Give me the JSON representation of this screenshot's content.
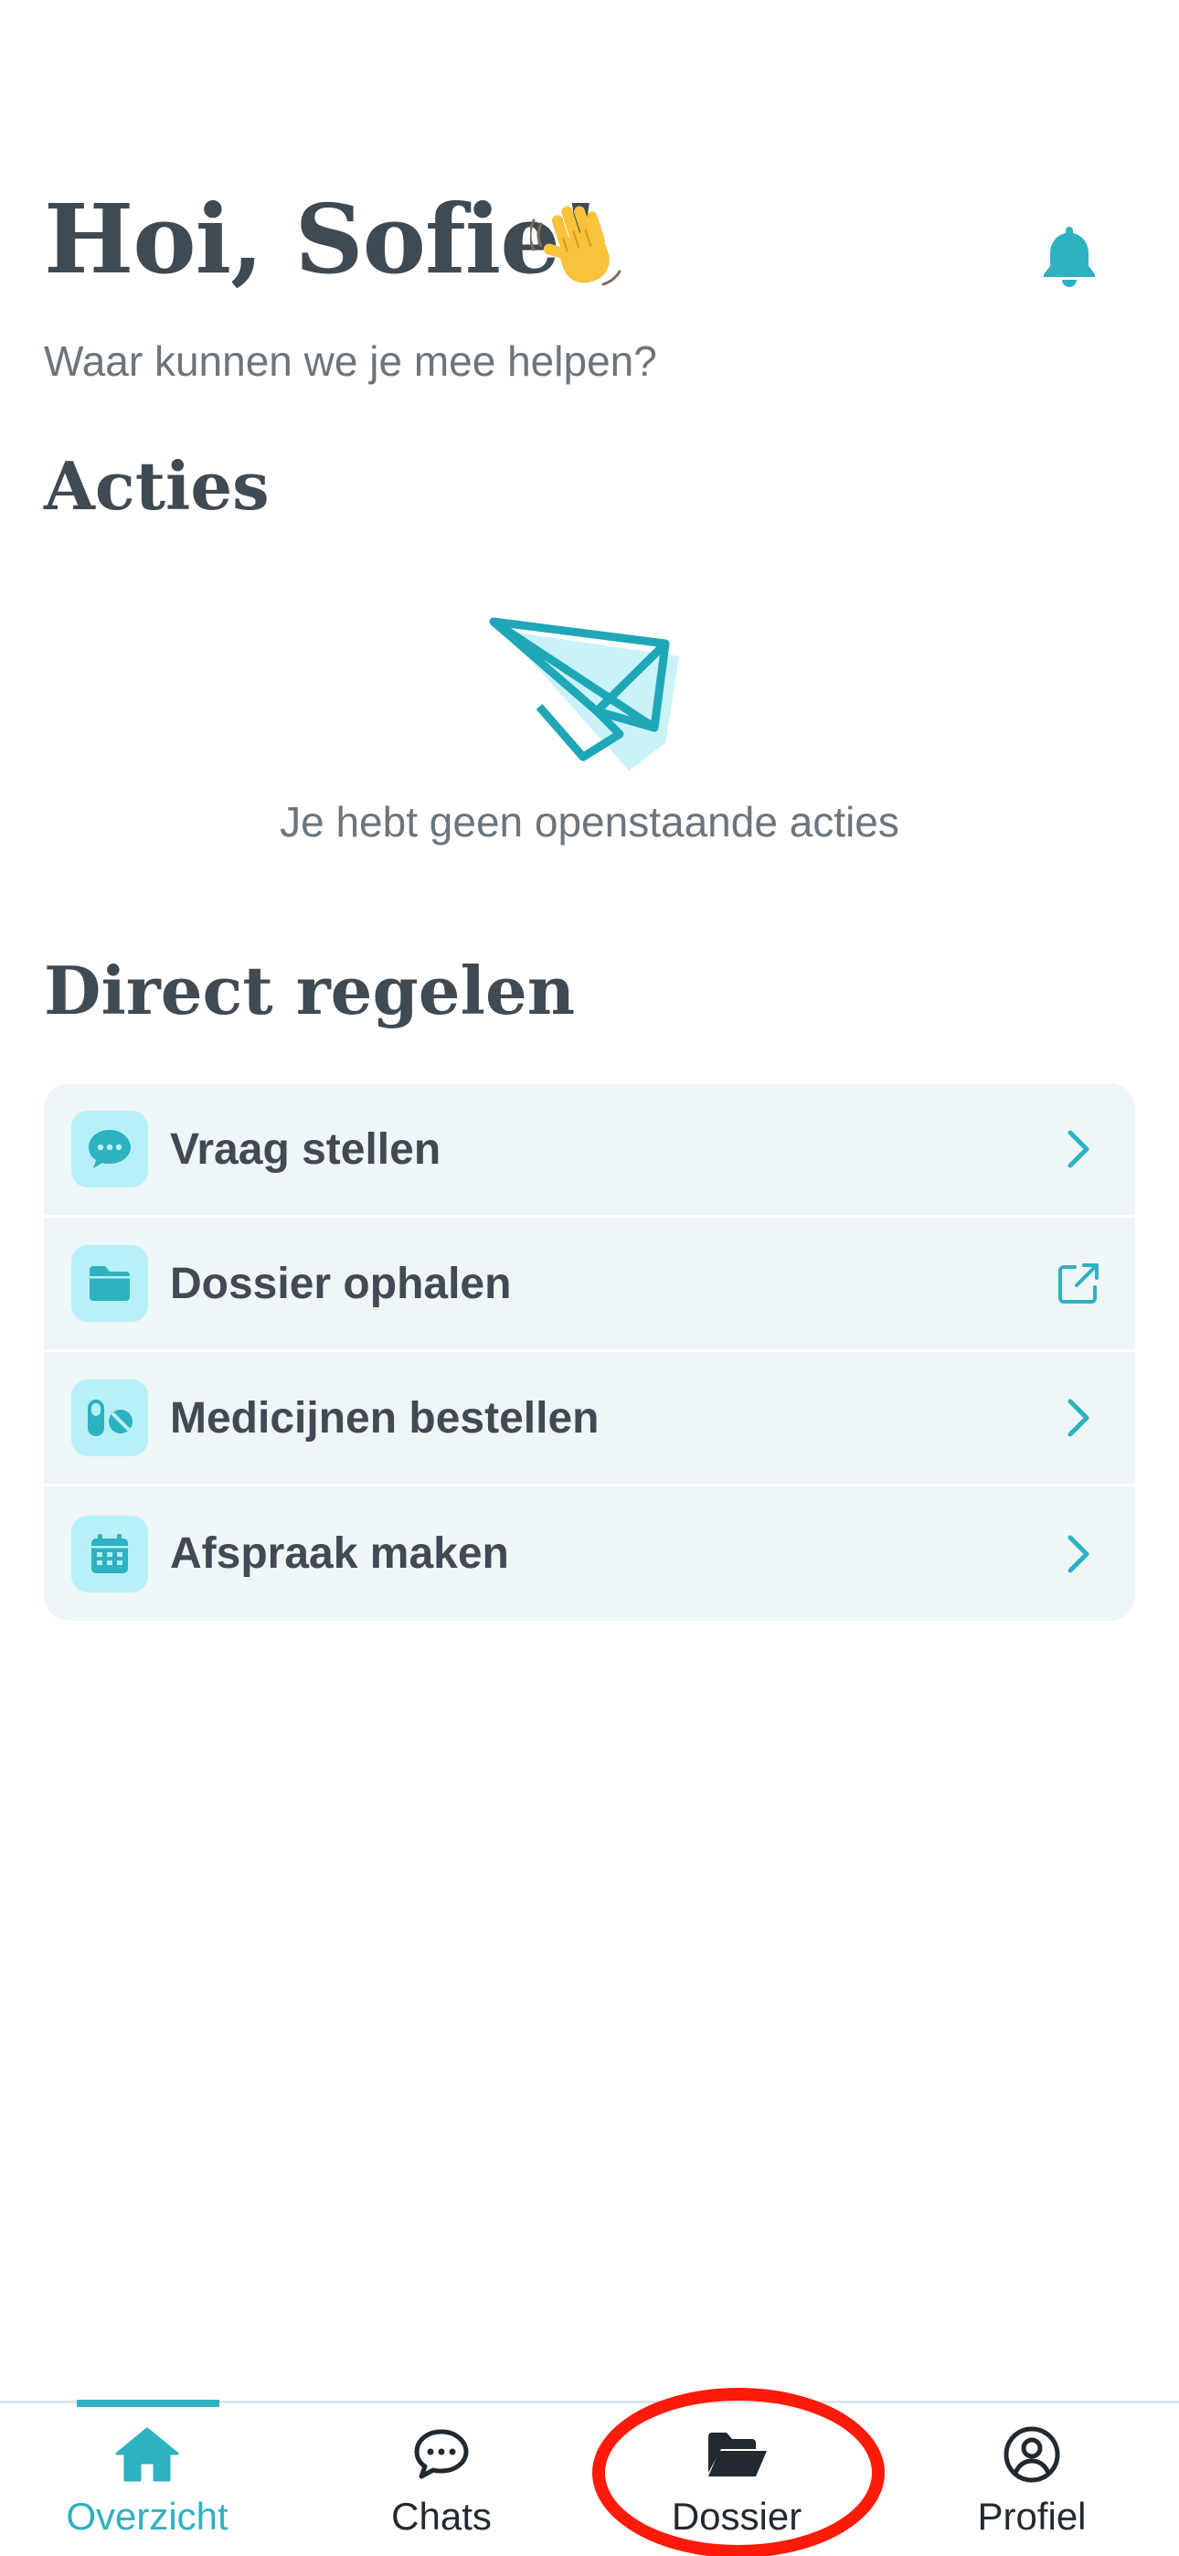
{
  "header": {
    "greeting": "Hoi, Sofie!",
    "subtitle": "Waar kunnen we je mee helpen?"
  },
  "acties": {
    "title": "Acties",
    "empty_text": "Je hebt geen openstaande acties"
  },
  "direct": {
    "title": "Direct regelen",
    "items": [
      {
        "label": "Vraag stellen",
        "icon": "chat-bubble-icon",
        "trail": "chevron-right-icon"
      },
      {
        "label": "Dossier ophalen",
        "icon": "folder-icon",
        "trail": "external-link-icon"
      },
      {
        "label": "Medicijnen bestellen",
        "icon": "pills-icon",
        "trail": "chevron-right-icon"
      },
      {
        "label": "Afspraak maken",
        "icon": "calendar-icon",
        "trail": "chevron-right-icon"
      }
    ]
  },
  "nav": {
    "items": [
      {
        "label": "Overzicht",
        "icon": "home-icon",
        "active": true
      },
      {
        "label": "Chats",
        "icon": "chat-icon",
        "active": false
      },
      {
        "label": "Dossier",
        "icon": "folder-open-icon",
        "active": false
      },
      {
        "label": "Profiel",
        "icon": "user-circle-icon",
        "active": false
      }
    ]
  },
  "colors": {
    "accent": "#2eb1c1",
    "text": "#3f4a52",
    "muted": "#6c757b",
    "list_bg": "#eef6f8",
    "icon_bg": "#b7f0f7",
    "annotation": "#ff1a0a"
  }
}
